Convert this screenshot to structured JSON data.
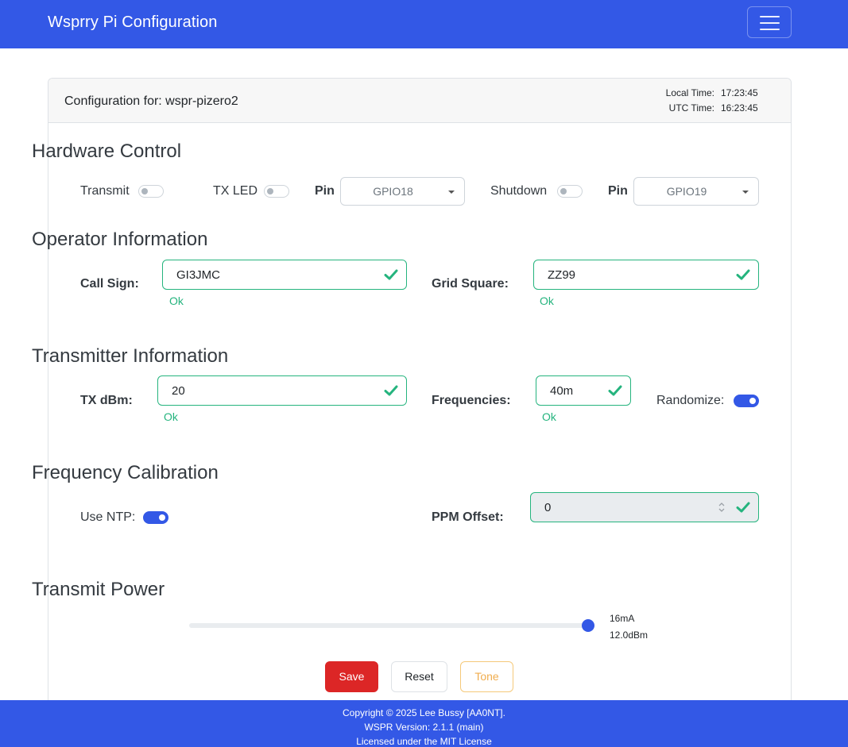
{
  "navbar": {
    "brand": "Wsprry Pi Configuration"
  },
  "header": {
    "config_label": "Configuration for: wspr-pizero2",
    "local_time_label": "Local Time:",
    "local_time": "17:23:45",
    "utc_time_label": "UTC Time:",
    "utc_time": "16:23:45"
  },
  "hardware": {
    "title": "Hardware Control",
    "transmit_label": "Transmit",
    "transmit_on": false,
    "txled_label": "TX LED",
    "txled_on": false,
    "pin_label": "Pin",
    "txled_pin": "GPIO18",
    "shutdown_label": "Shutdown",
    "shutdown_on": false,
    "shutdown_pin_label": "Pin",
    "shutdown_pin": "GPIO19"
  },
  "operator": {
    "title": "Operator Information",
    "callsign_label": "Call Sign:",
    "callsign": "GI3JMC",
    "callsign_status": "Ok",
    "grid_label": "Grid Square:",
    "grid": "ZZ99",
    "grid_status": "Ok"
  },
  "transmitter": {
    "title": "Transmitter Information",
    "dbm_label": "TX dBm:",
    "dbm": "20",
    "dbm_status": "Ok",
    "freq_label": "Frequencies:",
    "freq": "40m",
    "freq_status": "Ok",
    "randomize_label": "Randomize:",
    "randomize_on": true
  },
  "calibration": {
    "title": "Frequency Calibration",
    "ntp_label": "Use NTP:",
    "ntp_on": true,
    "ppm_label": "PPM Offset:",
    "ppm": "0"
  },
  "power": {
    "title": "Transmit Power",
    "level_fraction": 1.0,
    "current": "16mA",
    "dbm": "12.0dBm"
  },
  "buttons": {
    "save": "Save",
    "reset": "Reset",
    "tone": "Tone"
  },
  "footer": {
    "copyright": "Copyright © 2025 Lee Bussy [AA0NT].",
    "version": "WSPR Version: 2.1.1 (main)",
    "license": "Licensed under the MIT License"
  },
  "colors": {
    "primary": "#3358e6",
    "success": "#25b47e",
    "danger": "#dc2626",
    "warning": "#f0ad4e"
  }
}
